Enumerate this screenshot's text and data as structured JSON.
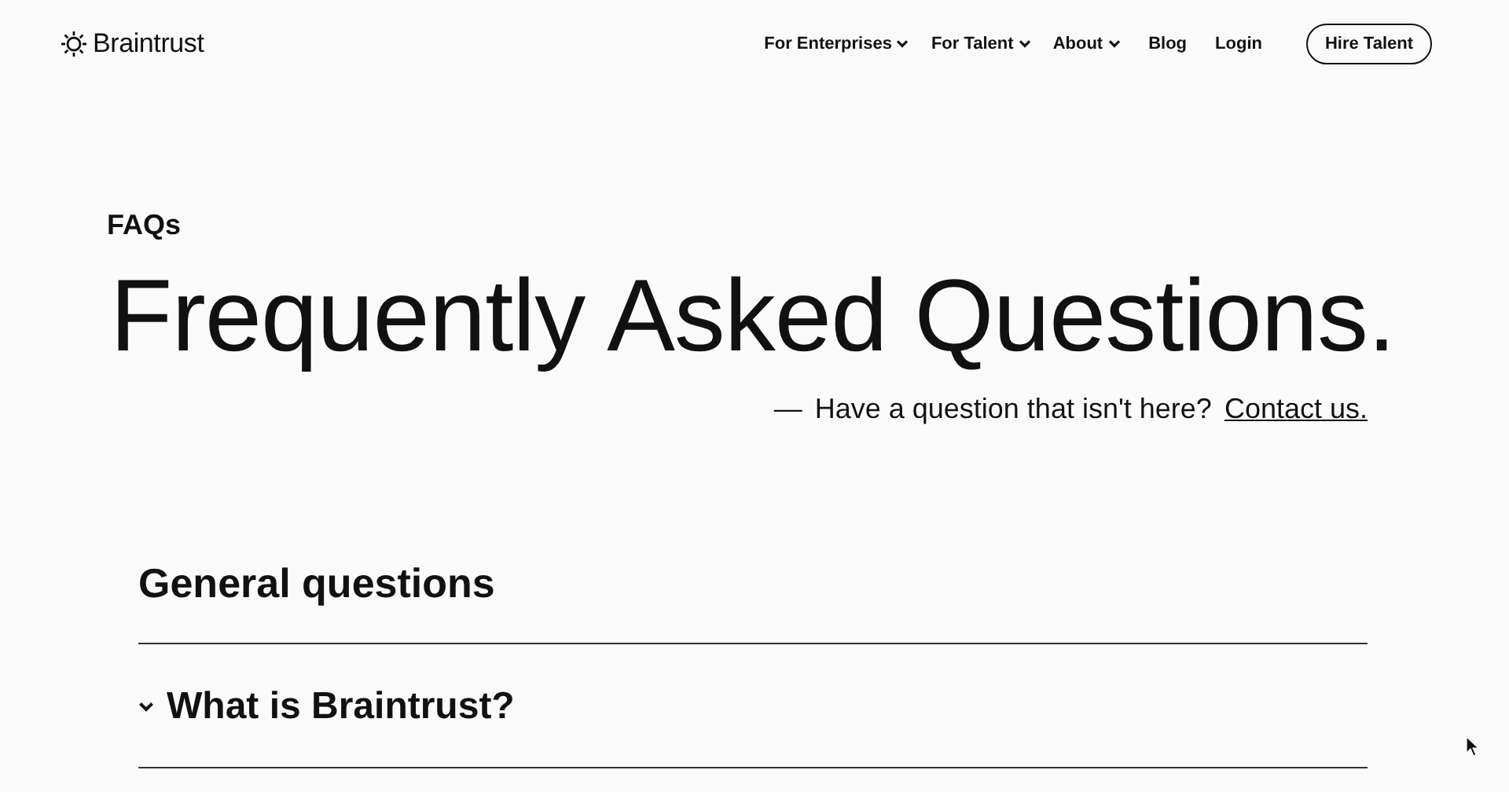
{
  "brand": {
    "name": "Braintrust"
  },
  "nav": [
    {
      "label": "For Enterprises",
      "kind": "menu"
    },
    {
      "label": "For Talent",
      "kind": "menu"
    },
    {
      "label": "About",
      "kind": "menu"
    },
    {
      "label": "Blog",
      "kind": "link"
    },
    {
      "label": "Login",
      "kind": "link"
    }
  ],
  "cta": {
    "label": "Hire Talent"
  },
  "hero": {
    "eyebrow": "FAQs",
    "title": "Frequently Asked Questions.",
    "dash": "—",
    "prompt": "Have a question that isn't here?",
    "link": "Contact us."
  },
  "section": {
    "title": "General questions",
    "items": [
      {
        "question": "What is Braintrust?",
        "expanded": false
      }
    ]
  }
}
